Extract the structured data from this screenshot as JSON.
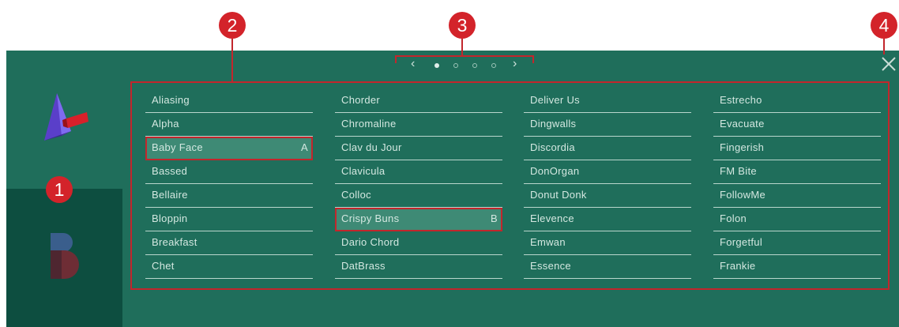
{
  "markers": [
    "1",
    "2",
    "3",
    "4"
  ],
  "pager": {
    "prev": "‹",
    "next": "›",
    "pages": 4,
    "current": 1
  },
  "columns": [
    [
      {
        "label": "Aliasing"
      },
      {
        "label": "Alpha"
      },
      {
        "label": "Baby Face",
        "tag": "A"
      },
      {
        "label": "Bassed"
      },
      {
        "label": "Bellaire"
      },
      {
        "label": "Bloppin"
      },
      {
        "label": "Breakfast"
      },
      {
        "label": "Chet"
      }
    ],
    [
      {
        "label": "Chorder"
      },
      {
        "label": "Chromaline"
      },
      {
        "label": "Clav du Jour"
      },
      {
        "label": "Clavicula"
      },
      {
        "label": "Colloc"
      },
      {
        "label": "Crispy Buns",
        "tag": "B"
      },
      {
        "label": "Dario Chord"
      },
      {
        "label": "DatBrass"
      }
    ],
    [
      {
        "label": "Deliver Us"
      },
      {
        "label": "Dingwalls"
      },
      {
        "label": "Discordia"
      },
      {
        "label": "DonOrgan"
      },
      {
        "label": "Donut Donk"
      },
      {
        "label": "Elevence"
      },
      {
        "label": "Emwan"
      },
      {
        "label": "Essence"
      }
    ],
    [
      {
        "label": "Estrecho"
      },
      {
        "label": "Evacuate"
      },
      {
        "label": "Fingerish"
      },
      {
        "label": "FM Bite"
      },
      {
        "label": "FollowMe"
      },
      {
        "label": "Folon"
      },
      {
        "label": "Forgetful"
      },
      {
        "label": "Frankie"
      }
    ]
  ],
  "icons": {
    "close": "close-icon",
    "logo_a": "sound-a-logo-icon",
    "logo_b": "sound-b-logo-icon"
  },
  "colors": {
    "panel": "#1f6e5b",
    "sidebar_dark": "#0d4e40",
    "marker": "#d3232a",
    "selected": "#3e8a75"
  }
}
